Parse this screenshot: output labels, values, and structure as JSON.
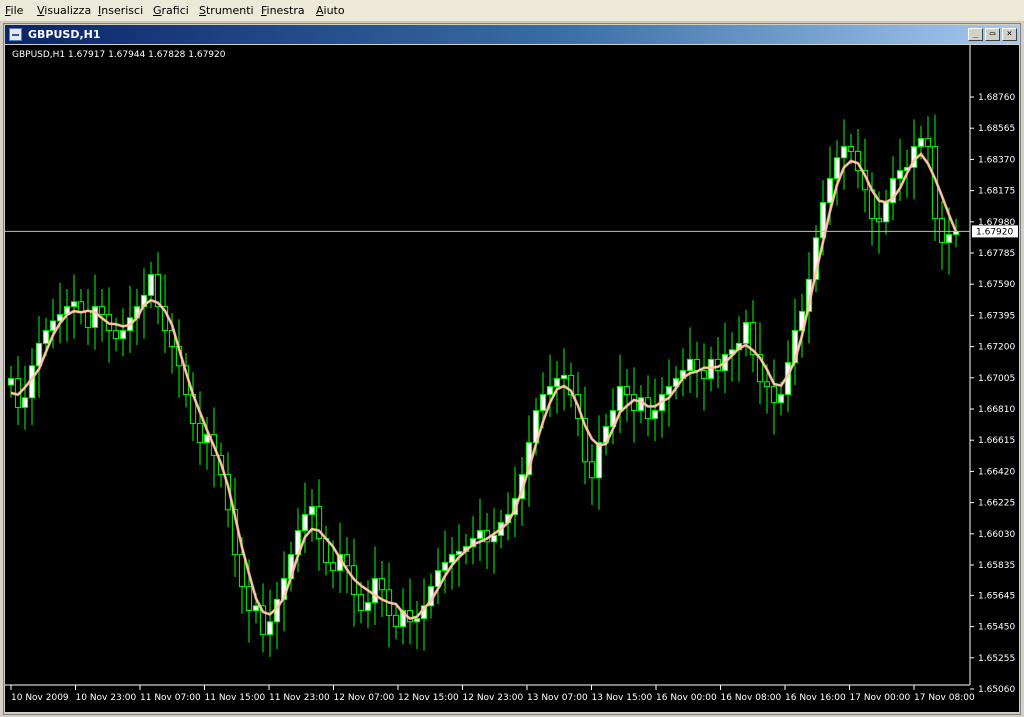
{
  "menu": [
    {
      "label": "File",
      "name": "menu-file"
    },
    {
      "label": "Visualizza",
      "name": "menu-visualizza"
    },
    {
      "label": "Inserisci",
      "name": "menu-inserisci"
    },
    {
      "label": "Grafici",
      "name": "menu-grafici"
    },
    {
      "label": "Strumenti",
      "name": "menu-strumenti"
    },
    {
      "label": "Finestra",
      "name": "menu-finestra"
    },
    {
      "label": "Aiuto",
      "name": "menu-aiuto"
    }
  ],
  "window": {
    "title": "GBPUSD,H1",
    "minimize_label": "_",
    "restore_label": "▭",
    "close_label": "×"
  },
  "chart": {
    "info_line": "GBPUSD,H1  1.67917 1.67944 1.67828 1.67920",
    "current_price_label": "1.67920",
    "colors": {
      "background": "#000000",
      "bull_candle": "#00ff00",
      "bull_body": "#ffffff",
      "ma_line": "#ffc0cb",
      "ma_highlight": "#ffd700",
      "price_line": "#c0c0c0",
      "axis": "#ffffff"
    }
  },
  "chart_data": {
    "type": "candlestick",
    "symbol": "GBPUSD",
    "timeframe": "H1",
    "last_ohlc": {
      "open": 1.67917,
      "high": 1.67944,
      "low": 1.67828,
      "close": 1.6792
    },
    "current_price": 1.6792,
    "ylim": [
      1.6506,
      1.6886
    ],
    "y_ticks": [
      "1.68760",
      "1.68565",
      "1.68370",
      "1.68175",
      "1.67980",
      "1.67785",
      "1.67590",
      "1.67395",
      "1.67200",
      "1.67005",
      "1.66810",
      "1.66615",
      "1.66420",
      "1.66225",
      "1.66030",
      "1.65835",
      "1.65645",
      "1.65450",
      "1.65255",
      "1.65060"
    ],
    "x_ticks": [
      "10 Nov 2009",
      "10 Nov 23:00",
      "11 Nov 07:00",
      "11 Nov 15:00",
      "11 Nov 23:00",
      "12 Nov 07:00",
      "12 Nov 15:00",
      "12 Nov 23:00",
      "13 Nov 07:00",
      "13 Nov 15:00",
      "16 Nov 00:00",
      "16 Nov 08:00",
      "16 Nov 16:00",
      "17 Nov 00:00",
      "17 Nov 08:00"
    ],
    "close": [
      1.67,
      1.6682,
      1.6688,
      1.6708,
      1.6722,
      1.673,
      1.6736,
      1.674,
      1.6745,
      1.6748,
      1.6742,
      1.6732,
      1.6745,
      1.674,
      1.673,
      1.6725,
      1.673,
      1.6738,
      1.6745,
      1.6752,
      1.6765,
      1.6745,
      1.673,
      1.672,
      1.6708,
      1.669,
      1.6672,
      1.666,
      1.6665,
      1.6652,
      1.664,
      1.6618,
      1.659,
      1.657,
      1.6555,
      1.6558,
      1.654,
      1.6548,
      1.6562,
      1.6575,
      1.659,
      1.6605,
      1.6615,
      1.662,
      1.66,
      1.6585,
      1.658,
      1.659,
      1.6583,
      1.6565,
      1.6555,
      1.656,
      1.6575,
      1.6568,
      1.6552,
      1.6545,
      1.6555,
      1.6548,
      1.655,
      1.6558,
      1.657,
      1.658,
      1.6585,
      1.659,
      1.6592,
      1.6595,
      1.66,
      1.6605,
      1.6598,
      1.6602,
      1.661,
      1.6615,
      1.6625,
      1.664,
      1.666,
      1.668,
      1.669,
      1.6695,
      1.67,
      1.6702,
      1.669,
      1.6675,
      1.6648,
      1.6638,
      1.666,
      1.667,
      1.668,
      1.6695,
      1.669,
      1.668,
      1.6688,
      1.6675,
      1.668,
      1.669,
      1.6695,
      1.67,
      1.6705,
      1.6712,
      1.6705,
      1.67,
      1.6712,
      1.6705,
      1.6715,
      1.6718,
      1.6722,
      1.6735,
      1.6715,
      1.6698,
      1.6695,
      1.6685,
      1.669,
      1.671,
      1.673,
      1.6742,
      1.6762,
      1.6788,
      1.681,
      1.6825,
      1.6838,
      1.6845,
      1.6842,
      1.683,
      1.6818,
      1.68,
      1.6798,
      1.681,
      1.6825,
      1.683,
      1.6832,
      1.6845,
      1.685,
      1.6845,
      1.68,
      1.6785,
      1.679,
      1.6792
    ]
  }
}
